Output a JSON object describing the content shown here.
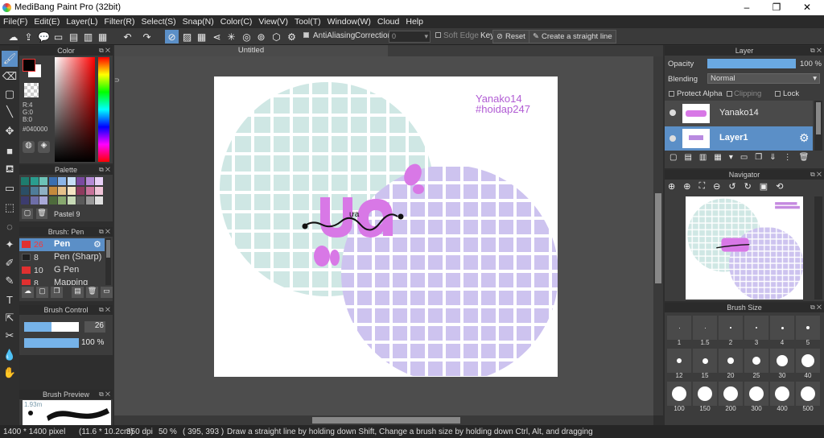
{
  "window": {
    "title": "MediBang Paint Pro (32bit)"
  },
  "menu": [
    "File(F)",
    "Edit(E)",
    "Layer(L)",
    "Filter(R)",
    "Select(S)",
    "Snap(N)",
    "Color(C)",
    "View(V)",
    "Tool(T)",
    "Window(W)",
    "Cloud",
    "Help"
  ],
  "toolbar": {
    "antialias_label": "AntiAliasing",
    "correction_label": "Correction",
    "correction_value": "0",
    "soft_edge_label": "Soft Edge",
    "key_label": "Key",
    "reset_label": "Reset",
    "straight_line_label": "Create a straight line"
  },
  "color_panel": {
    "title": "Color",
    "r": "R:4",
    "g": "G:0",
    "b": "B:0",
    "hex": "#040000"
  },
  "palette_panel": {
    "title": "Palette",
    "name": "Pastel 9"
  },
  "brush_panel": {
    "title": "Brush: Pen",
    "items": [
      {
        "size": "26",
        "name": "Pen",
        "color": "#e03030",
        "selected": true
      },
      {
        "size": "8",
        "name": "Pen (Sharp)",
        "color": "#202020",
        "selected": false
      },
      {
        "size": "10",
        "name": "G Pen",
        "color": "#e03030",
        "selected": false
      },
      {
        "size": "8",
        "name": "Mapping Pen",
        "color": "#e03030",
        "selected": false
      }
    ]
  },
  "brush_control": {
    "title": "Brush Control",
    "size_value": "26",
    "size_fill": 0.5,
    "opacity_value": "100 %",
    "opacity_fill": 1.0
  },
  "brush_preview": {
    "title": "Brush Preview",
    "size_text": "1.93m"
  },
  "canvas": {
    "tab_title": "Untitled",
    "watermark_line1": "Yanako14",
    "watermark_line2": "#hoidap247",
    "sticker_text": "ựa",
    "colors": {
      "teal": "#cfe7e4",
      "purple": "#cdc3ef",
      "pink": "#d878e6",
      "ink": "#111111"
    }
  },
  "layer_panel": {
    "title": "Layer",
    "opacity_label": "Opacity",
    "opacity_value": "100 %",
    "opacity_fill": 1.0,
    "blending_label": "Blending",
    "blending_value": "Normal",
    "protect_alpha_label": "Protect Alpha",
    "clipping_label": "Clipping",
    "lock_label": "Lock",
    "layers": [
      {
        "name": "Yanako14",
        "selected": false
      },
      {
        "name": "Layer1",
        "selected": true
      }
    ]
  },
  "navigator_panel": {
    "title": "Navigator"
  },
  "brush_size_panel": {
    "title": "Brush Size",
    "sizes": [
      "1",
      "1.5",
      "2",
      "3",
      "4",
      "5",
      "12",
      "15",
      "20",
      "25",
      "30",
      "40",
      "100",
      "150",
      "200",
      "300",
      "400",
      "500"
    ]
  },
  "status": {
    "dimensions": "1400 * 1400 pixel",
    "physical": "(11.6 * 10.2cm)",
    "dpi": "350 dpi",
    "zoom": "50 %",
    "coords": "( 395, 393 )",
    "hint": "Draw a straight line by holding down Shift, Change a brush size by holding down Ctrl, Alt, and dragging"
  }
}
